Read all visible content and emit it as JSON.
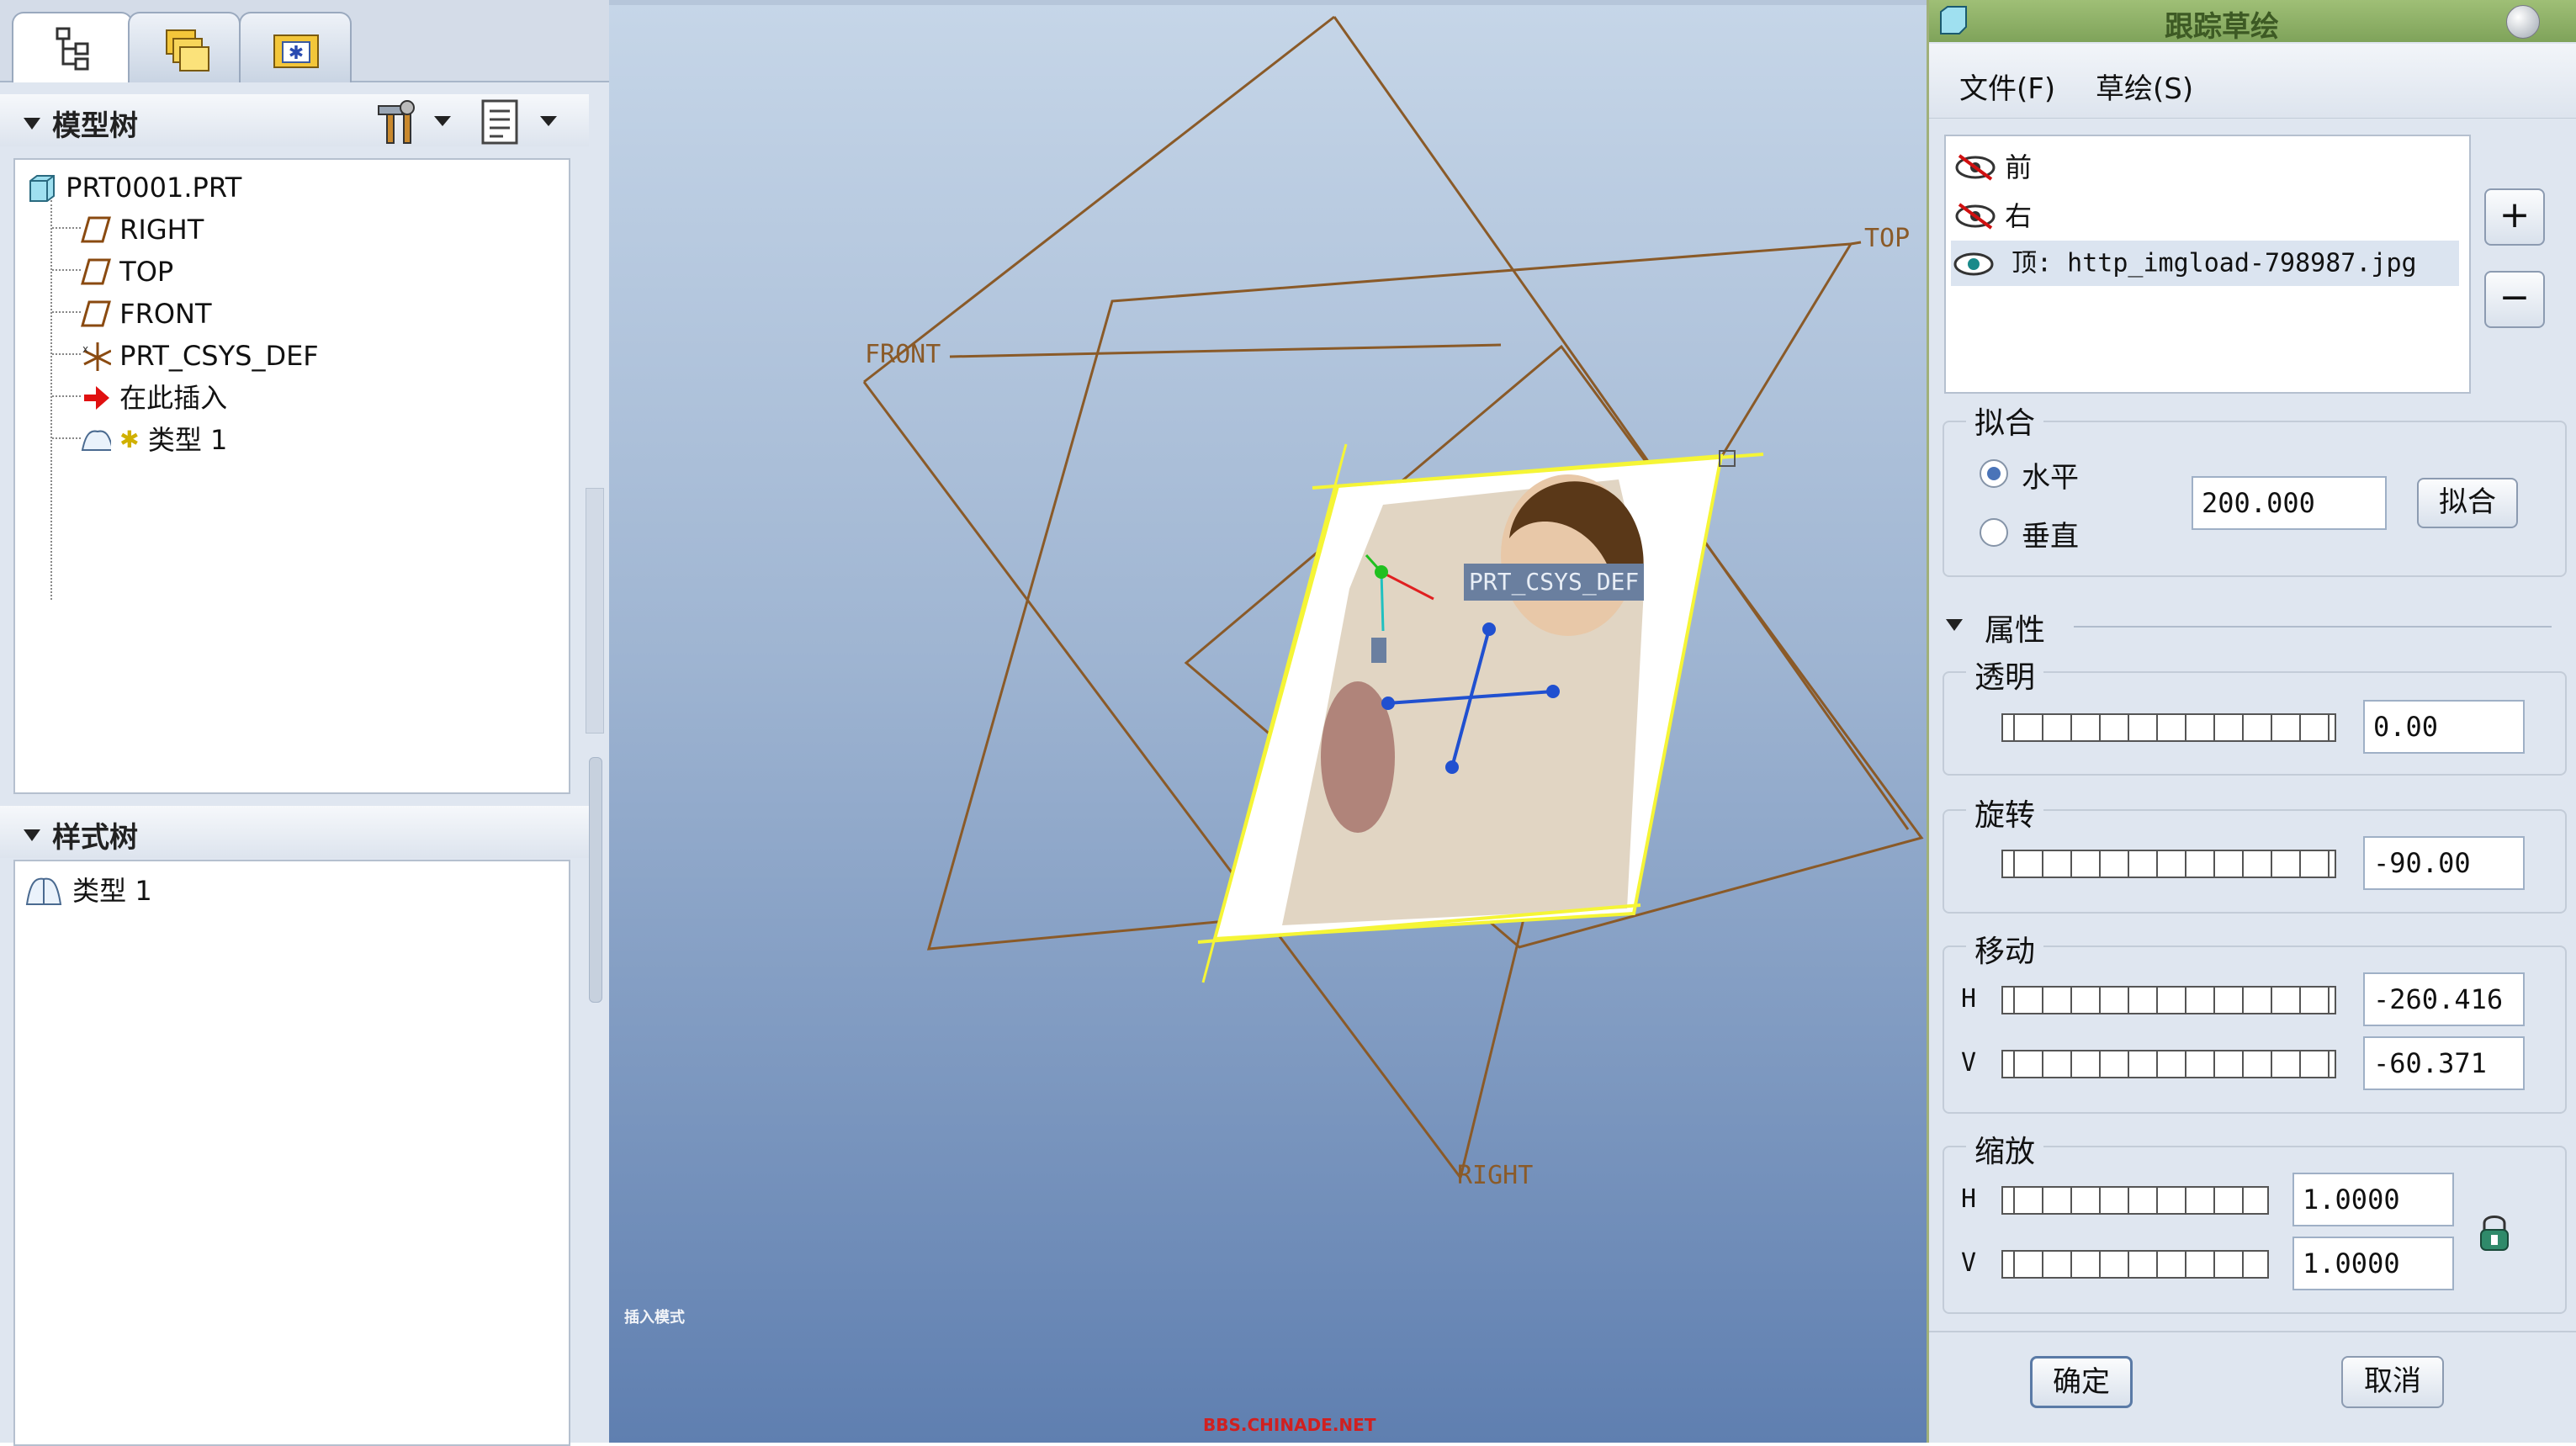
{
  "model_tree": {
    "header": "模型树",
    "items": [
      {
        "label": "PRT0001.PRT",
        "icon": "part-icon"
      },
      {
        "label": "RIGHT",
        "icon": "datum-plane-icon"
      },
      {
        "label": "TOP",
        "icon": "datum-plane-icon"
      },
      {
        "label": "FRONT",
        "icon": "datum-plane-icon"
      },
      {
        "label": "PRT_CSYS_DEF",
        "icon": "csys-icon"
      },
      {
        "label": "在此插入",
        "icon": "insert-arrow-icon"
      },
      {
        "label": "类型 1",
        "icon": "style-icon"
      }
    ]
  },
  "style_tree": {
    "header": "样式树",
    "items": [
      {
        "label": "类型 1",
        "icon": "style-icon"
      }
    ]
  },
  "viewport": {
    "plane_labels": {
      "front": "FRONT",
      "top": "TOP",
      "right": "RIGHT"
    },
    "csys_label": "PRT_CSYS_DEF",
    "watermark": "BBS.CHINADE.NET",
    "corner_note": "插入模式"
  },
  "dialog": {
    "title": "跟踪草绘",
    "menu": [
      "文件(F)",
      "草绘(S)"
    ],
    "views": [
      {
        "label": "前",
        "visible": false
      },
      {
        "label": "右",
        "visible": false
      },
      {
        "label": "顶: http_imgload-798987.jpg",
        "visible": true
      }
    ],
    "add_label": "+",
    "remove_label": "−",
    "fit": {
      "group": "拟合",
      "options": [
        "水平",
        "垂直"
      ],
      "selected": "水平",
      "value": "200.000",
      "button": "拟合"
    },
    "properties_header": "属性",
    "transparency": {
      "label": "透明",
      "value": "0.00"
    },
    "rotation": {
      "label": "旋转",
      "value": "-90.00"
    },
    "move": {
      "label": "移动",
      "h_label": "H",
      "h_value": "-260.416",
      "v_label": "V",
      "v_value": "-60.371"
    },
    "scale": {
      "label": "缩放",
      "h_label": "H",
      "h_value": "1.0000",
      "v_label": "V",
      "v_value": "1.0000"
    },
    "ok": "确定",
    "cancel": "取消"
  },
  "colors": {
    "datum": "#8a5a28",
    "accent": "#4a74b8",
    "title_green": "#8cae64",
    "highlight": "#f5f536"
  }
}
